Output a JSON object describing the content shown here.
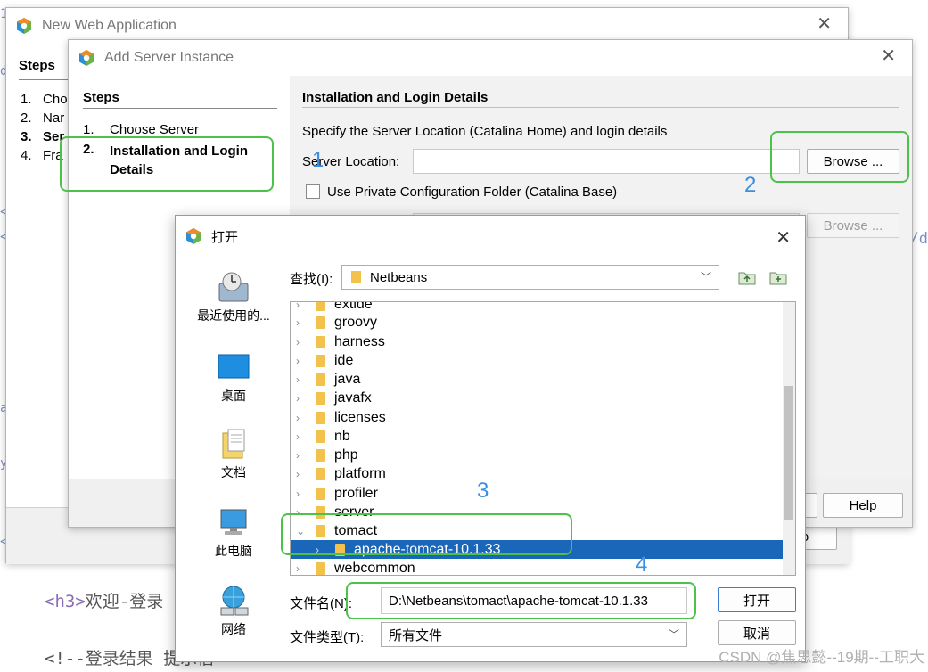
{
  "editor": {
    "line1_tag": "<h3>",
    "line1_text": "欢迎-登录",
    "line2": "<!--登录结果 提示信"
  },
  "web_app": {
    "title": "New Web Application",
    "steps_heading": "Steps",
    "steps": [
      {
        "num": "1.",
        "label": "Cho"
      },
      {
        "num": "2.",
        "label": "Nar"
      },
      {
        "num": "3.",
        "label": "Ser"
      },
      {
        "num": "4.",
        "label": "Fra"
      }
    ]
  },
  "add_server": {
    "title": "Add Server Instance",
    "steps_heading": "Steps",
    "steps": [
      {
        "num": "1.",
        "label": "Choose Server"
      },
      {
        "num": "2.",
        "label": "Installation and Login Details"
      }
    ],
    "section_title": "Installation and Login Details",
    "description": "Specify the Server Location (Catalina Home) and login details",
    "server_location_label": "Server Location:",
    "server_location_value": "",
    "browse_label": "Browse ...",
    "private_config_label": "Use Private Configuration Folder (Catalina Base)",
    "private_config_checked": false,
    "browse2_label": "Browse ...",
    "help_label": "Help"
  },
  "open_dialog": {
    "title": "打开",
    "lookin_label": "查找(I):",
    "lookin_value": "Netbeans",
    "places": [
      {
        "icon": "recent-icon",
        "label": "最近使用的..."
      },
      {
        "icon": "desktop-icon",
        "label": "桌面"
      },
      {
        "icon": "documents-icon",
        "label": "文档"
      },
      {
        "icon": "this-pc-icon",
        "label": "此电脑"
      },
      {
        "icon": "network-icon",
        "label": "网络"
      }
    ],
    "tree": [
      {
        "name": "extide",
        "expanded": false,
        "indent": 0,
        "selected": false
      },
      {
        "name": "groovy",
        "expanded": false,
        "indent": 0,
        "selected": false
      },
      {
        "name": "harness",
        "expanded": false,
        "indent": 0,
        "selected": false
      },
      {
        "name": "ide",
        "expanded": false,
        "indent": 0,
        "selected": false
      },
      {
        "name": "java",
        "expanded": false,
        "indent": 0,
        "selected": false
      },
      {
        "name": "javafx",
        "expanded": false,
        "indent": 0,
        "selected": false
      },
      {
        "name": "licenses",
        "expanded": false,
        "indent": 0,
        "selected": false
      },
      {
        "name": "nb",
        "expanded": false,
        "indent": 0,
        "selected": false
      },
      {
        "name": "php",
        "expanded": false,
        "indent": 0,
        "selected": false
      },
      {
        "name": "platform",
        "expanded": false,
        "indent": 0,
        "selected": false
      },
      {
        "name": "profiler",
        "expanded": false,
        "indent": 0,
        "selected": false
      },
      {
        "name": "server",
        "expanded": false,
        "indent": 0,
        "selected": false
      },
      {
        "name": "tomact",
        "expanded": true,
        "indent": 0,
        "selected": false
      },
      {
        "name": "apache-tomcat-10.1.33",
        "expanded": false,
        "indent": 1,
        "selected": true
      },
      {
        "name": "webcommon",
        "expanded": false,
        "indent": 0,
        "selected": false
      }
    ],
    "filename_label": "文件名(N):",
    "filename_value": "D:\\Netbeans\\tomact\\apache-tomcat-10.1.33",
    "filetype_label": "文件类型(T):",
    "filetype_value": "所有文件",
    "open_label": "打开",
    "cancel_label": "取消"
  },
  "annotations": [
    "1",
    "2",
    "3",
    "4"
  ],
  "watermark": "CSDN @焦思懿--19期--工职大",
  "colors": {
    "accent_green": "#4cc24a",
    "annotation_blue": "#3a8fe0",
    "selection_blue": "#1a66b8",
    "folder_yellow": "#f3c24d"
  }
}
